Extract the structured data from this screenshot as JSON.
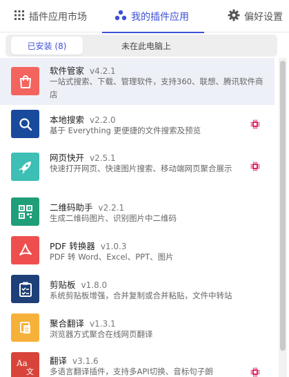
{
  "tabs": {
    "market": {
      "label": "插件应用市场",
      "icon": "grid-icon"
    },
    "mine": {
      "label": "我的插件应用",
      "icon": "plugins-icon"
    },
    "settings": {
      "label": "偏好设置",
      "icon": "gear-icon"
    }
  },
  "active_tab": "mine",
  "segment": {
    "installed_label": "已安装 (8)",
    "not_installed_label": "未在此电脑上",
    "selected": "installed"
  },
  "plugins": [
    {
      "name": "软件管家",
      "version": "v4.2.1",
      "desc": "一站式搜索、下载、管理软件，支持360、联想、腾讯软件商店",
      "icon": "shopping-bag-icon",
      "color": "#f4645f",
      "selected": true,
      "chip": false
    },
    {
      "name": "本地搜索",
      "version": "v2.2.0",
      "desc": "基于 Everything 更便捷的文件搜索及预览",
      "icon": "magnifier-icon",
      "color": "#1a4a9c",
      "selected": false,
      "chip": true
    },
    {
      "name": "网页快开",
      "version": "v2.5.1",
      "desc": "快速打开网页、快速图片搜索、移动端网页聚合展示",
      "icon": "rocket-icon",
      "color": "#3dbfb5",
      "selected": false,
      "chip": true
    },
    {
      "name": "二维码助手",
      "version": "v2.2.1",
      "desc": "生成二维码图片、识别图片中二维码",
      "icon": "qrcode-icon",
      "color": "#1f9e7a",
      "selected": false,
      "chip": false
    },
    {
      "name": "PDF 转换器",
      "version": "v1.0.3",
      "desc": "PDF 转 Word、Excel、PPT、图片",
      "icon": "pdf-icon",
      "color": "#ef4e4e",
      "selected": false,
      "chip": false
    },
    {
      "name": "剪贴板",
      "version": "v1.8.0",
      "desc": "系统剪贴板增强，合并复制或合并粘贴，文件中转站",
      "icon": "clipboard-icon",
      "color": "#1e3f78",
      "selected": false,
      "chip": false
    },
    {
      "name": "聚合翻译",
      "version": "v1.3.1",
      "desc": "浏览器方式聚合在线网页翻译",
      "icon": "translate-doc-icon",
      "color": "#f6b13a",
      "selected": false,
      "chip": false
    },
    {
      "name": "翻译",
      "version": "v3.1.6",
      "desc": "多语言翻译插件，支持多API切换、音标句子朗",
      "icon": "translate-aa-icon",
      "color": "#d8443a",
      "selected": false,
      "chip": true
    }
  ],
  "colors": {
    "accent": "#3c4fd6",
    "chip": "#e0245e",
    "selected_row": "#eef0f7"
  }
}
